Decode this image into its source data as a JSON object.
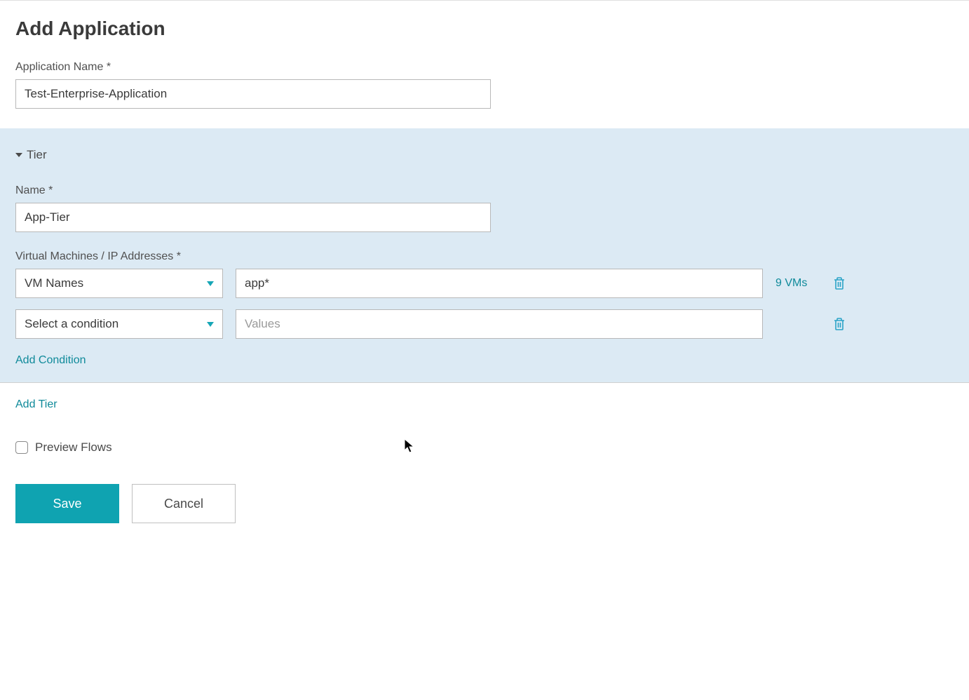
{
  "page": {
    "title": "Add Application"
  },
  "appName": {
    "label": "Application Name *",
    "value": "Test-Enterprise-Application"
  },
  "tier": {
    "toggleLabel": "Tier",
    "nameLabel": "Name *",
    "nameValue": "App-Tier",
    "vmLabel": "Virtual Machines / IP Addresses *",
    "rows": [
      {
        "conditionLabel": "VM Names",
        "value": "app*",
        "valuePlaceholder": "",
        "count": "9 VMs"
      },
      {
        "conditionLabel": "Select a condition",
        "value": "",
        "valuePlaceholder": "Values",
        "count": ""
      }
    ],
    "addConditionLabel": "Add Condition"
  },
  "addTierLabel": "Add Tier",
  "preview": {
    "label": "Preview Flows",
    "checked": false
  },
  "buttons": {
    "save": "Save",
    "cancel": "Cancel"
  }
}
